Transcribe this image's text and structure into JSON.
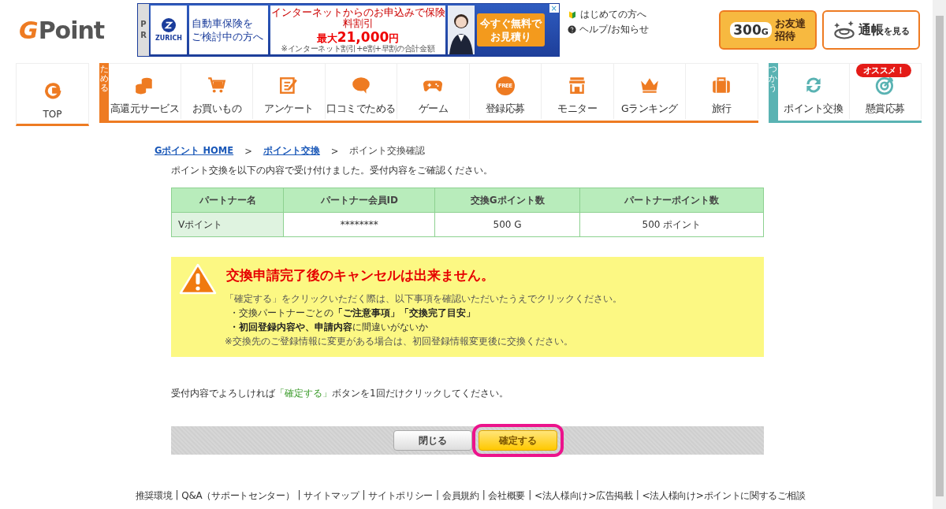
{
  "header": {
    "logo": {
      "g": "G",
      "rest": "Point"
    },
    "ad": {
      "pr": "PR",
      "brand": "ZURICH",
      "copy": [
        "自動車保険を",
        "ご検討中の方へ"
      ],
      "offer_top": "インターネットからのお申込みで保険料割引",
      "offer_prefix": "最大",
      "offer_amount": "21,000",
      "offer_unit": "円",
      "offer_note": "※インターネット割引+e割+早割の合計金額",
      "cta": [
        "今すぐ無料で",
        "お見積り"
      ],
      "close": "×"
    },
    "links": [
      {
        "label": "はじめての方へ"
      },
      {
        "label": "ヘルプ/お知らせ"
      }
    ],
    "promo_buttons": [
      {
        "kind": "friend",
        "amount": "300",
        "unit": "G",
        "label": [
          "お友達",
          "招待"
        ]
      },
      {
        "kind": "passbook",
        "label": "通帳",
        "suffix": "を見る"
      }
    ]
  },
  "nav": {
    "top": {
      "label": "TOP"
    },
    "groups": [
      {
        "kind": "earn",
        "tag": "ためる",
        "items": [
          {
            "label": "高還元サービス"
          },
          {
            "label": "お買いもの"
          },
          {
            "label": "アンケート"
          },
          {
            "label": "口コミでためる"
          },
          {
            "label": "ゲーム"
          },
          {
            "label": "登録応募",
            "icon_text": "FREE"
          },
          {
            "label": "モニター"
          },
          {
            "label": "Gランキング"
          },
          {
            "label": "旅行"
          }
        ]
      },
      {
        "kind": "use",
        "tag": "つかう",
        "items": [
          {
            "label": "ポイント交換"
          },
          {
            "label": "懸賞応募",
            "badge": "オススメ！"
          }
        ]
      }
    ]
  },
  "breadcrumb": {
    "items": [
      {
        "label": "Gポイント HOME",
        "link": true
      },
      {
        "label": "ポイント交換",
        "link": true
      },
      {
        "label": "ポイント交換確認",
        "link": false
      }
    ],
    "separator": ">"
  },
  "intro": "ポイント交換を以下の内容で受け付けました。受付内容をご確認ください。",
  "table": {
    "columns": [
      "パートナー名",
      "パートナー会員ID",
      "交換Gポイント数",
      "パートナーポイント数"
    ],
    "rows": [
      [
        "Vポイント",
        "********",
        "500 G",
        "500 ポイント"
      ]
    ]
  },
  "notice": {
    "title": "交換申請完了後のキャンセルは出来ません。",
    "lines": [
      {
        "kind": "text",
        "text": "「確定する」をクリックいただく際は、以下事項を確認いただいたうえでクリックください。"
      },
      {
        "kind": "bullet",
        "text": "・交換パートナーごとの**「ご注意事項」「交換完了目安」**"
      },
      {
        "kind": "bullet",
        "text": "**・初回登録内容や、申請内容**に間違いがないか"
      },
      {
        "kind": "text",
        "text": "※交換先のご登録情報に変更がある場合は、初回登録情報変更後に交換ください。"
      }
    ]
  },
  "confirm_text": {
    "before": "受付内容でよろしければ",
    "highlight": "「確定する」",
    "after": "ボタンを1回だけクリックしてください。"
  },
  "buttons": [
    {
      "kind": "close",
      "label": "閉じる",
      "highlighted": false
    },
    {
      "kind": "confirm",
      "label": "確定する",
      "highlighted": true
    }
  ],
  "footer": {
    "separator": "|",
    "links": [
      "推奨環境",
      "Q&A（サポートセンター）",
      "サイトマップ",
      "サイトポリシー",
      "会員規約",
      "会社概要",
      "<法人様向け>広告掲載",
      "<法人様向け>ポイントに関するご相談"
    ]
  }
}
